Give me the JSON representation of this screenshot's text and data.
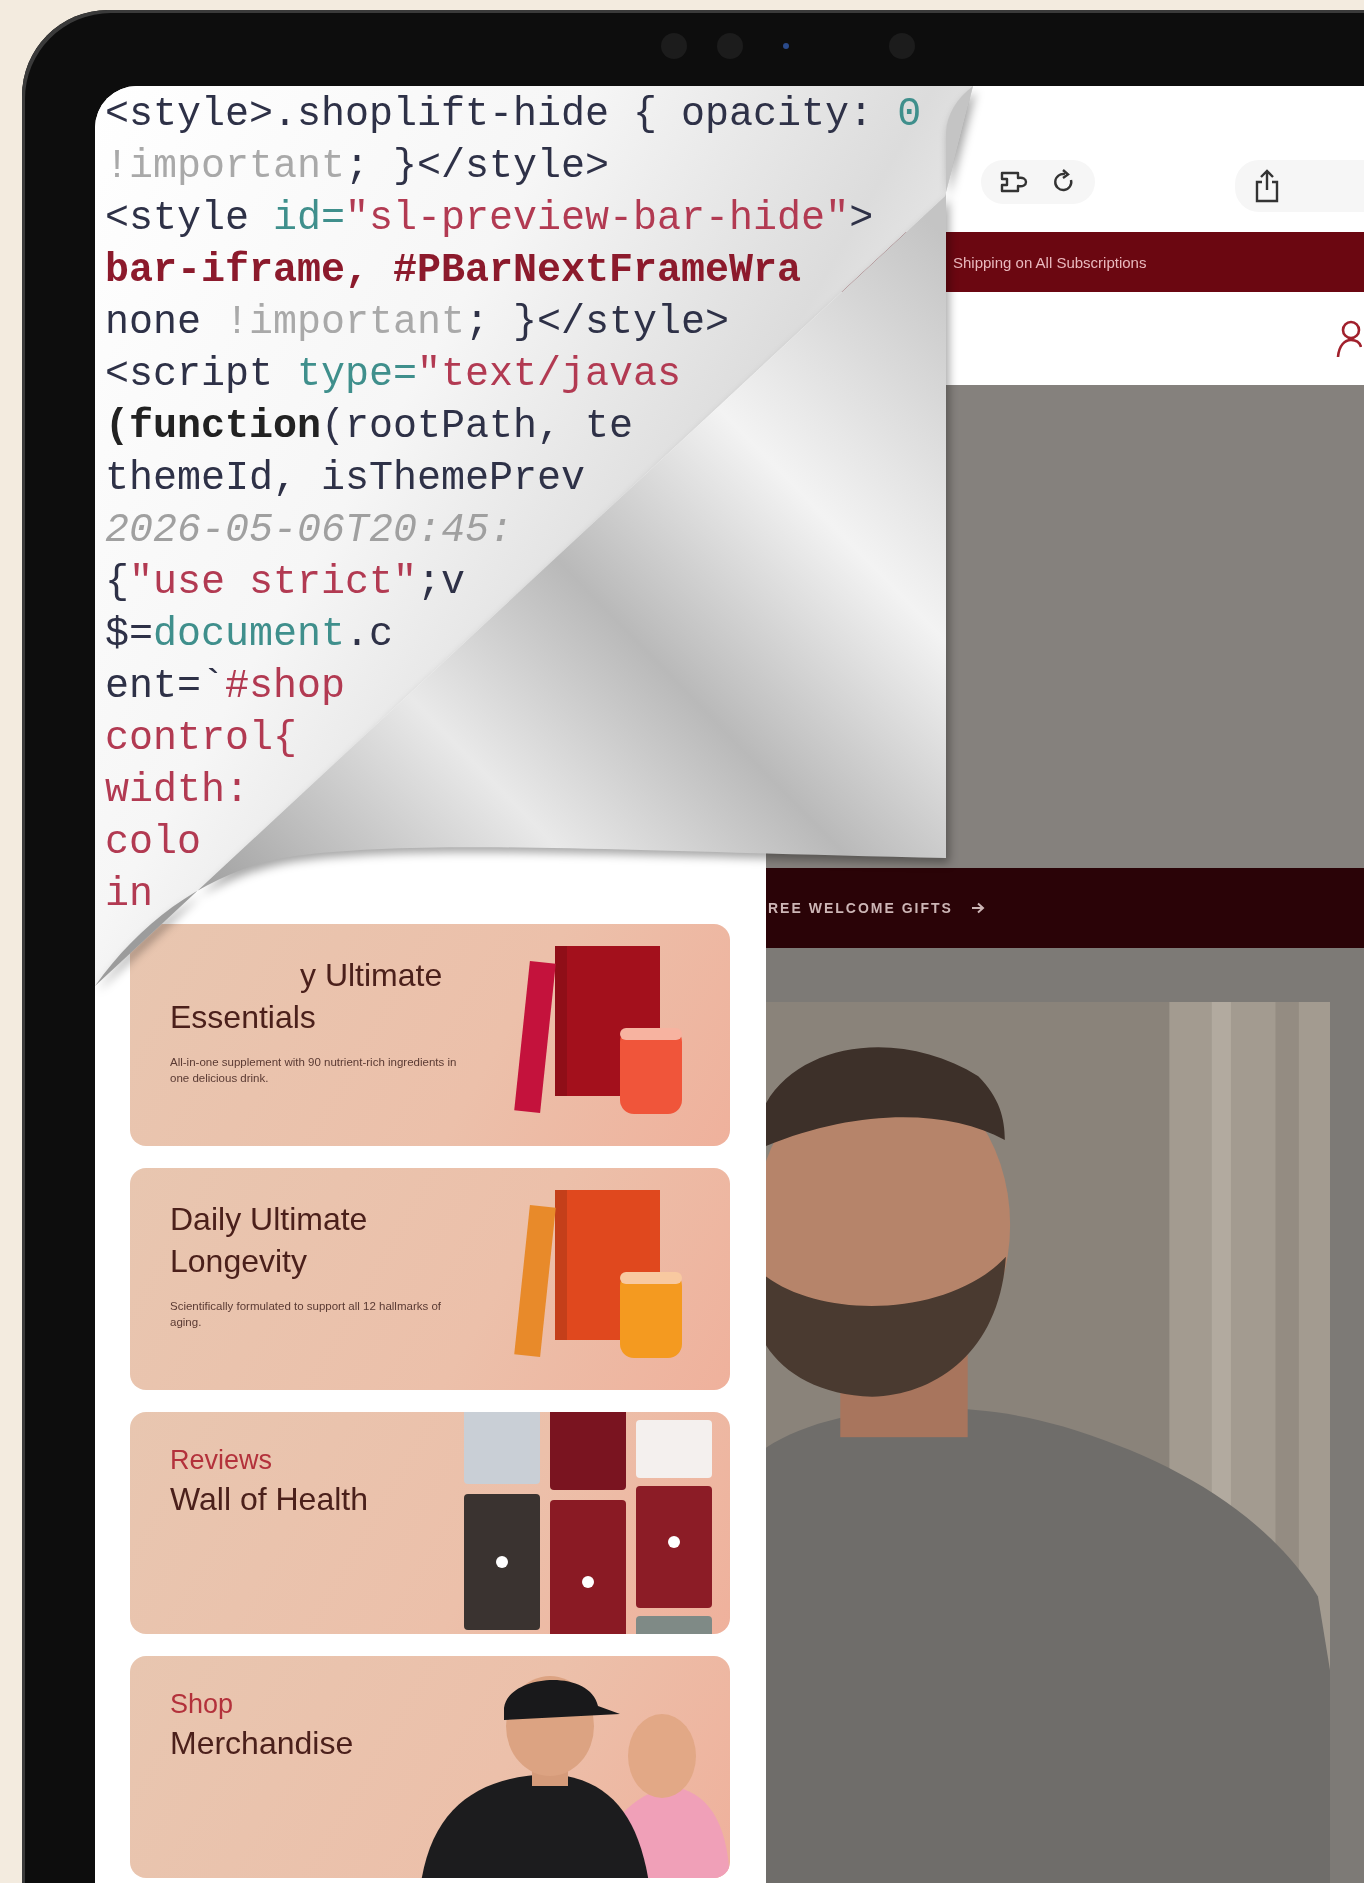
{
  "code_view": {
    "lines": [
      [
        {
          "kind": "tag",
          "text": "<style>.shoplift-hide { opacity: "
        },
        {
          "kind": "number",
          "text": "0"
        }
      ],
      [
        {
          "kind": "muted",
          "text": "!important"
        },
        {
          "kind": "tag",
          "text": "; }</style>"
        }
      ],
      [
        {
          "kind": "tag",
          "text": "<style "
        },
        {
          "kind": "attr",
          "text": "id="
        },
        {
          "kind": "string",
          "text": "\"sl-preview-bar-hide\""
        },
        {
          "kind": "tag",
          "text": ">"
        }
      ],
      [
        {
          "kind": "selector",
          "text": "bar-iframe, #PBarNextFrameWra"
        }
      ],
      [
        {
          "kind": "tag",
          "text": "none "
        },
        {
          "kind": "muted",
          "text": "!important"
        },
        {
          "kind": "tag",
          "text": "; }</style>"
        }
      ],
      [
        {
          "kind": "tag",
          "text": "<script "
        },
        {
          "kind": "attr",
          "text": "type="
        },
        {
          "kind": "string",
          "text": "\"text/javas"
        }
      ],
      [
        {
          "kind": "keyword",
          "text": "(function"
        },
        {
          "kind": "tag",
          "text": "(rootPath, te"
        }
      ],
      [
        {
          "kind": "tag",
          "text": "themeId, isThemePrev"
        }
      ],
      [
        {
          "kind": "comment",
          "text": "2026-05-06T20:45:"
        }
      ],
      [
        {
          "kind": "tag",
          "text": "{"
        },
        {
          "kind": "string",
          "text": "\"use strict\""
        },
        {
          "kind": "tag",
          "text": ";v"
        }
      ],
      [
        {
          "kind": "tag",
          "text": "$="
        },
        {
          "kind": "attr",
          "text": "document"
        },
        {
          "kind": "tag",
          "text": ".c"
        }
      ],
      [
        {
          "kind": "tag",
          "text": "ent=`"
        },
        {
          "kind": "string",
          "text": "#shop"
        }
      ],
      [
        {
          "kind": "string",
          "text": "control{"
        }
      ],
      [
        {
          "kind": "string",
          "text": "width:"
        }
      ],
      [
        {
          "kind": "string",
          "text": "colo"
        }
      ],
      [
        {
          "kind": "string",
          "text": "in"
        }
      ]
    ]
  },
  "cards": [
    {
      "kind": "product",
      "title_lines": [
        "y Ultimate",
        "Essentials"
      ],
      "description": "All-in-one supplement with 90 nutrient-rich ingredients in one delicious drink."
    },
    {
      "kind": "product",
      "title_lines": [
        "Daily Ultimate",
        "Longevity"
      ],
      "description": "Scientifically formulated to support all 12 hallmarks of aging."
    },
    {
      "kind": "reviews",
      "eyebrow": "Reviews",
      "title_lines": [
        "Wall of Health"
      ]
    },
    {
      "kind": "merch",
      "eyebrow": "Shop",
      "title_lines": [
        "Merchandise"
      ]
    }
  ],
  "announcement": "Shipping on All Subscriptions",
  "promo_bar": {
    "text": "REE WELCOME GIFTS"
  }
}
